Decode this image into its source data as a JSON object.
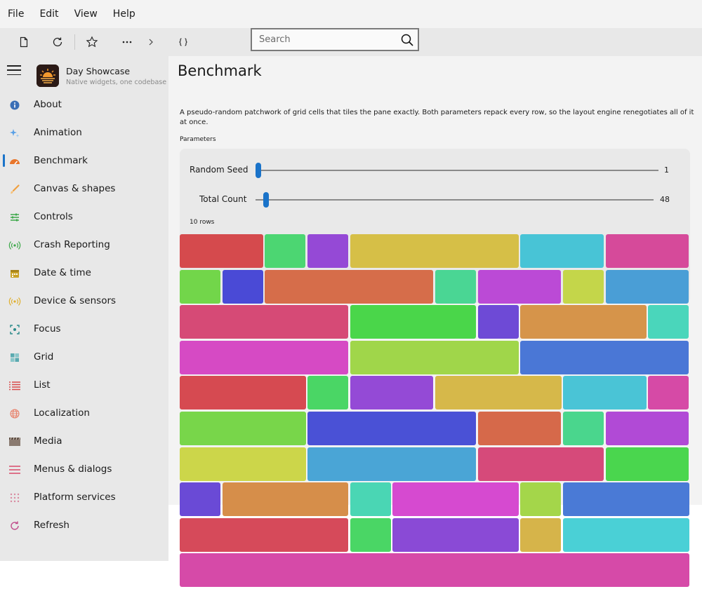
{
  "menu": [
    "File",
    "Edit",
    "View",
    "Help"
  ],
  "search": {
    "placeholder": "Search"
  },
  "app": {
    "title": "Day Showcase",
    "subtitle": "Native widgets, one codebase"
  },
  "nav": [
    {
      "label": "About",
      "icon": "info-icon",
      "color": "#3b6fb6"
    },
    {
      "label": "Animation",
      "icon": "sparkle-icon",
      "color": "#5aa0e6"
    },
    {
      "label": "Benchmark",
      "icon": "gauge-icon",
      "color": "#e8762c",
      "active": true
    },
    {
      "label": "Canvas & shapes",
      "icon": "brush-icon",
      "color": "#f0a040"
    },
    {
      "label": "Controls",
      "icon": "sliders-icon",
      "color": "#3da84a"
    },
    {
      "label": "Crash Reporting",
      "icon": "broadcast-icon",
      "color": "#3da84a"
    },
    {
      "label": "Date & time",
      "icon": "calendar-icon",
      "color": "#c9a227"
    },
    {
      "label": "Device & sensors",
      "icon": "broadcast-icon",
      "color": "#e0b030"
    },
    {
      "label": "Focus",
      "icon": "focus-icon",
      "color": "#2a8a8a"
    },
    {
      "label": "Grid",
      "icon": "grid-icon",
      "color": "#3a9aa0"
    },
    {
      "label": "List",
      "icon": "list-icon",
      "color": "#d94a4a"
    },
    {
      "label": "Localization",
      "icon": "globe-icon",
      "color": "#e8806a"
    },
    {
      "label": "Media",
      "icon": "clapper-icon",
      "color": "#8a7a70"
    },
    {
      "label": "Menus & dialogs",
      "icon": "menu-icon",
      "color": "#d94a6a"
    },
    {
      "label": "Platform services",
      "icon": "dots-grid-icon",
      "color": "#d98aa0"
    },
    {
      "label": "Refresh",
      "icon": "refresh-icon",
      "color": "#c04a8a"
    }
  ],
  "page": {
    "title": "Benchmark",
    "description": "A pseudo-random patchwork of grid cells that tiles the pane exactly. Both parameters repack every row, so the layout engine renegotiates all of it at once.",
    "params_label": "Parameters",
    "rows_label": "10 rows"
  },
  "sliders": {
    "seed": {
      "label": "Random Seed",
      "value": "1",
      "fraction": 0.0
    },
    "count": {
      "label": "Total Count",
      "value": "48",
      "fraction": 0.02
    }
  },
  "grid": {
    "columns": 12,
    "rows": [
      [
        [
          2,
          "#d54a4d"
        ],
        [
          1,
          "#4cd672"
        ],
        [
          1,
          "#9549d6"
        ],
        [
          4,
          "#d6bf47"
        ],
        [
          2,
          "#48c4d6"
        ],
        [
          2,
          "#d64a9a"
        ]
      ],
      [
        [
          1,
          "#72d64a"
        ],
        [
          1,
          "#4a4ad6"
        ],
        [
          4,
          "#d66d4a"
        ],
        [
          1,
          "#4ad694"
        ],
        [
          2,
          "#bb4ad6"
        ],
        [
          1,
          "#c4d64a"
        ],
        [
          2,
          "#4a9ed6"
        ]
      ],
      [
        [
          4,
          "#d64a76"
        ],
        [
          3,
          "#4ad64a"
        ],
        [
          1,
          "#6e4ad6"
        ],
        [
          3,
          "#d6944a"
        ],
        [
          1,
          "#4ad6bb"
        ]
      ],
      [
        [
          4,
          "#d64ac4"
        ],
        [
          4,
          "#a0d64a"
        ],
        [
          4,
          "#4a77d6"
        ]
      ],
      [
        [
          3,
          "#d64a51"
        ],
        [
          1,
          "#4ad665"
        ],
        [
          2,
          "#944ad6"
        ],
        [
          3,
          "#d6b84a"
        ],
        [
          2,
          "#4ac4d6"
        ],
        [
          1,
          "#d64aa6"
        ]
      ],
      [
        [
          3,
          "#78d64a"
        ],
        [
          4,
          "#4a51d6"
        ],
        [
          2,
          "#d6694a"
        ],
        [
          1,
          "#4ad68d"
        ],
        [
          2,
          "#b14ad6"
        ]
      ],
      [
        [
          3,
          "#ccd64a"
        ],
        [
          4,
          "#4aa5d6"
        ],
        [
          3,
          "#d64a7a"
        ],
        [
          2,
          "#4ad64e"
        ]
      ],
      [
        [
          1,
          "#6a4ad6"
        ],
        [
          3,
          "#d68e4a"
        ],
        [
          1,
          "#4ad6b4"
        ],
        [
          3,
          "#d64ad0"
        ],
        [
          1,
          "#a4d64a"
        ],
        [
          3,
          "#4a7ad6"
        ]
      ],
      [
        [
          4,
          "#d64a5a"
        ],
        [
          1,
          "#4ad665"
        ],
        [
          3,
          "#8a4ad6"
        ],
        [
          1,
          "#d6b44a"
        ],
        [
          3,
          "#4ad0d6"
        ]
      ],
      [
        [
          12,
          "#d64aa8"
        ]
      ]
    ]
  }
}
